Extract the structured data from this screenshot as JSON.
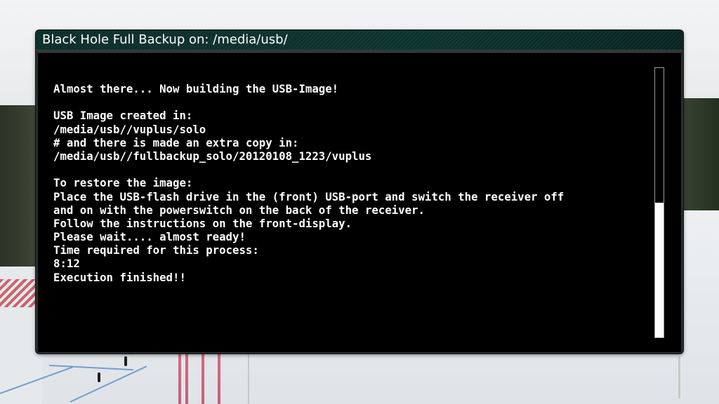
{
  "window": {
    "title": "Black Hole Full Backup on: /media/usb/"
  },
  "console": {
    "lines": [
      "Almost there... Now building the USB-Image!",
      "",
      "USB Image created in:",
      "/media/usb//vuplus/solo",
      "# and there is made an extra copy in:",
      "/media/usb//fullbackup_solo/20120108_1223/vuplus",
      "",
      "To restore the image:",
      "Place the USB-flash drive in the (front) USB-port and switch the receiver off",
      "and on with the powerswitch on the back of the receiver.",
      "Follow the instructions on the front-display.",
      "Please wait.... almost ready!",
      "Time required for this process:",
      "8:12",
      "Execution finished!!"
    ]
  },
  "scrollbar": {
    "visible_fraction": 0.5,
    "position": "bottom"
  },
  "colors": {
    "titlebar": "#0d3430",
    "console_background": "#000000",
    "console_text": "#ffffff",
    "scroll_thumb": "#ffffff"
  }
}
